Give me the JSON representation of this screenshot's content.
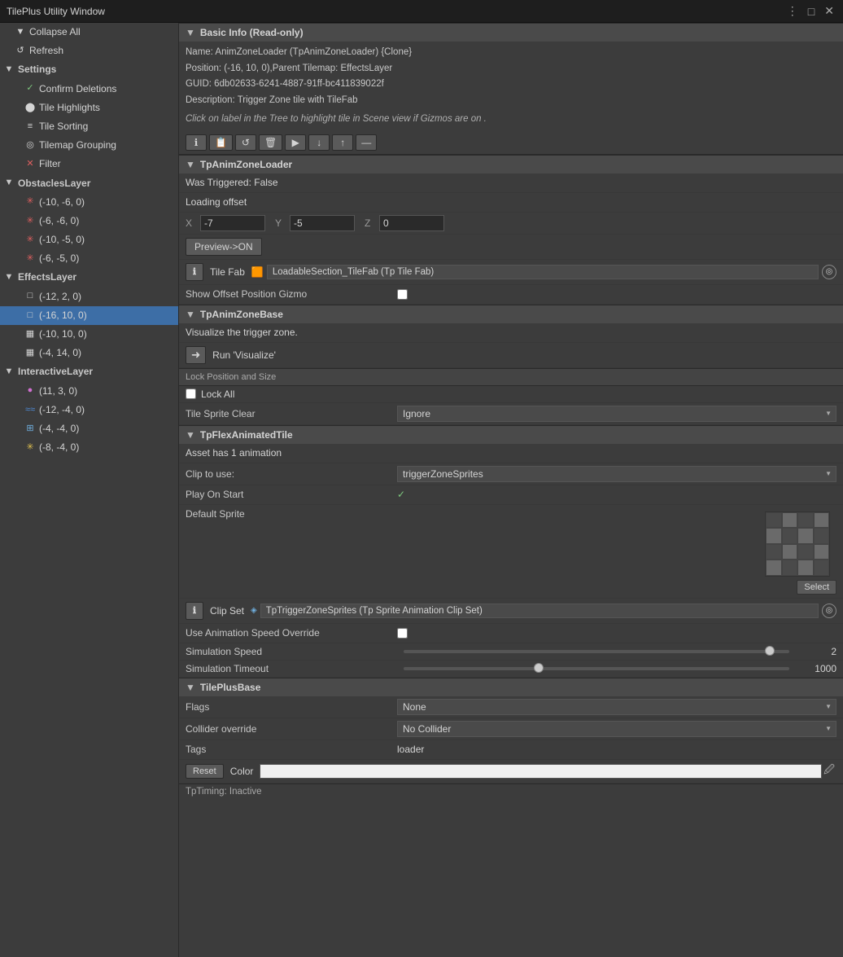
{
  "window": {
    "title": "TilePlus Utility Window"
  },
  "titlebar": {
    "controls": [
      "⋮",
      "□",
      "✕"
    ]
  },
  "left_panel": {
    "items": [
      {
        "id": "collapse-all",
        "indent": 1,
        "icon": "▼",
        "label": "Collapse All"
      },
      {
        "id": "refresh",
        "indent": 1,
        "icon": "↺",
        "label": "Refresh"
      },
      {
        "id": "settings",
        "indent": 0,
        "icon": "▼",
        "label": "Settings",
        "type": "section"
      },
      {
        "id": "confirm-deletions",
        "indent": 1,
        "icon": "✓",
        "label": "Confirm Deletions"
      },
      {
        "id": "tile-highlights",
        "indent": 1,
        "icon": "⬤",
        "label": "Tile Highlights"
      },
      {
        "id": "tile-sorting",
        "indent": 1,
        "icon": "≡",
        "label": "Tile Sorting"
      },
      {
        "id": "tilemap-grouping",
        "indent": 1,
        "icon": "◎",
        "label": "Tilemap Grouping"
      },
      {
        "id": "filter",
        "indent": 1,
        "icon": "✕",
        "label": "Filter"
      },
      {
        "id": "obstacles-layer",
        "indent": 0,
        "icon": "▼",
        "label": "ObstaclesLayer",
        "type": "section"
      },
      {
        "id": "obs1",
        "indent": 2,
        "icon": "✳",
        "label": "(-10, -6, 0)"
      },
      {
        "id": "obs2",
        "indent": 2,
        "icon": "✳",
        "label": "(-6, -6, 0)"
      },
      {
        "id": "obs3",
        "indent": 2,
        "icon": "✳",
        "label": "(-10, -5, 0)"
      },
      {
        "id": "obs4",
        "indent": 2,
        "icon": "✳",
        "label": "(-6, -5, 0)"
      },
      {
        "id": "effects-layer",
        "indent": 0,
        "icon": "▼",
        "label": "EffectsLayer",
        "type": "section"
      },
      {
        "id": "eff1",
        "indent": 2,
        "icon": "□",
        "label": "(-12, 2, 0)"
      },
      {
        "id": "eff2",
        "indent": 2,
        "icon": "□",
        "label": "(-16, 10, 0)",
        "selected": true
      },
      {
        "id": "eff3",
        "indent": 2,
        "icon": "▦",
        "label": "(-10, 10, 0)"
      },
      {
        "id": "eff4",
        "indent": 2,
        "icon": "▦",
        "label": "(-4, 14, 0)"
      },
      {
        "id": "interactive-layer",
        "indent": 0,
        "icon": "▼",
        "label": "InteractiveLayer",
        "type": "section"
      },
      {
        "id": "int1",
        "indent": 2,
        "icon": "●",
        "label": "(11, 3, 0)"
      },
      {
        "id": "int2",
        "indent": 2,
        "icon": "≈",
        "label": "(-12, -4, 0)"
      },
      {
        "id": "int3",
        "indent": 2,
        "icon": "⊞",
        "label": "(-4, -4, 0)"
      },
      {
        "id": "int4",
        "indent": 2,
        "icon": "✳",
        "label": "(-8, -4, 0)"
      }
    ]
  },
  "right_panel": {
    "basic_info": {
      "section_title": "Basic Info (Read-only)",
      "name_line": "Name: AnimZoneLoader (TpAnimZoneLoader) {Clone}",
      "position_line": "Position: (-16, 10, 0),Parent Tilemap: EffectsLayer",
      "guid_line": "GUID: 6db02633-6241-4887-91ff-bc411839022f",
      "description_line": "Description: Trigger Zone tile with TileFab",
      "hint": "Click on label in the Tree to highlight tile in Scene view if Gizmos are on .",
      "toolbar_buttons": [
        "ℹ",
        "📋",
        "↺",
        "🗑",
        "▶",
        "↓",
        "↑",
        "—"
      ]
    },
    "tp_anim_zone_loader": {
      "section_title": "TpAnimZoneLoader",
      "was_triggered": "Was Triggered: False",
      "loading_offset_label": "Loading offset",
      "x_label": "X",
      "x_value": "-7",
      "y_label": "Y",
      "y_value": "-5",
      "z_label": "Z",
      "z_value": "0",
      "preview_btn": "Preview->ON",
      "tile_fab_label": "Tile Fab",
      "tile_fab_value": "LoadableSection_TileFab (Tp Tile Fab)",
      "show_offset_label": "Show Offset Position Gizmo"
    },
    "tp_anim_zone_base": {
      "section_title": "TpAnimZoneBase",
      "visualize_label": "Visualize the trigger zone.",
      "run_visualize_btn": "Run 'Visualize'"
    },
    "lock_section": {
      "header": "Lock Position and Size",
      "lock_all_label": "Lock All",
      "tile_sprite_clear_label": "Tile Sprite Clear",
      "tile_sprite_clear_value": "Ignore"
    },
    "tp_flex_animated_tile": {
      "section_title": "TpFlexAnimatedTile",
      "asset_info": "Asset has 1 animation",
      "clip_to_use_label": "Clip to use:",
      "clip_to_use_value": "triggerZoneSprites",
      "play_on_start_label": "Play On Start",
      "play_on_start_checked": true,
      "default_sprite_label": "Default Sprite",
      "select_btn": "Select",
      "clip_set_label": "Clip Set",
      "clip_set_value": "TpTriggerZoneSprites (Tp Sprite Animation Clip Set)",
      "use_anim_speed_label": "Use Animation Speed Override",
      "simulation_speed_label": "Simulation Speed",
      "simulation_speed_value": "2",
      "simulation_speed_pct": 95,
      "simulation_timeout_label": "Simulation Timeout",
      "simulation_timeout_value": "1000",
      "simulation_timeout_pct": 35
    },
    "tile_plus_base": {
      "section_title": "TilePlusBase",
      "flags_label": "Flags",
      "flags_value": "None",
      "collider_override_label": "Collider override",
      "collider_override_value": "No Collider",
      "tags_label": "Tags",
      "tags_value": "loader",
      "reset_btn": "Reset",
      "color_label": "Color",
      "tp_timing_label": "TpTiming: Inactive"
    }
  }
}
